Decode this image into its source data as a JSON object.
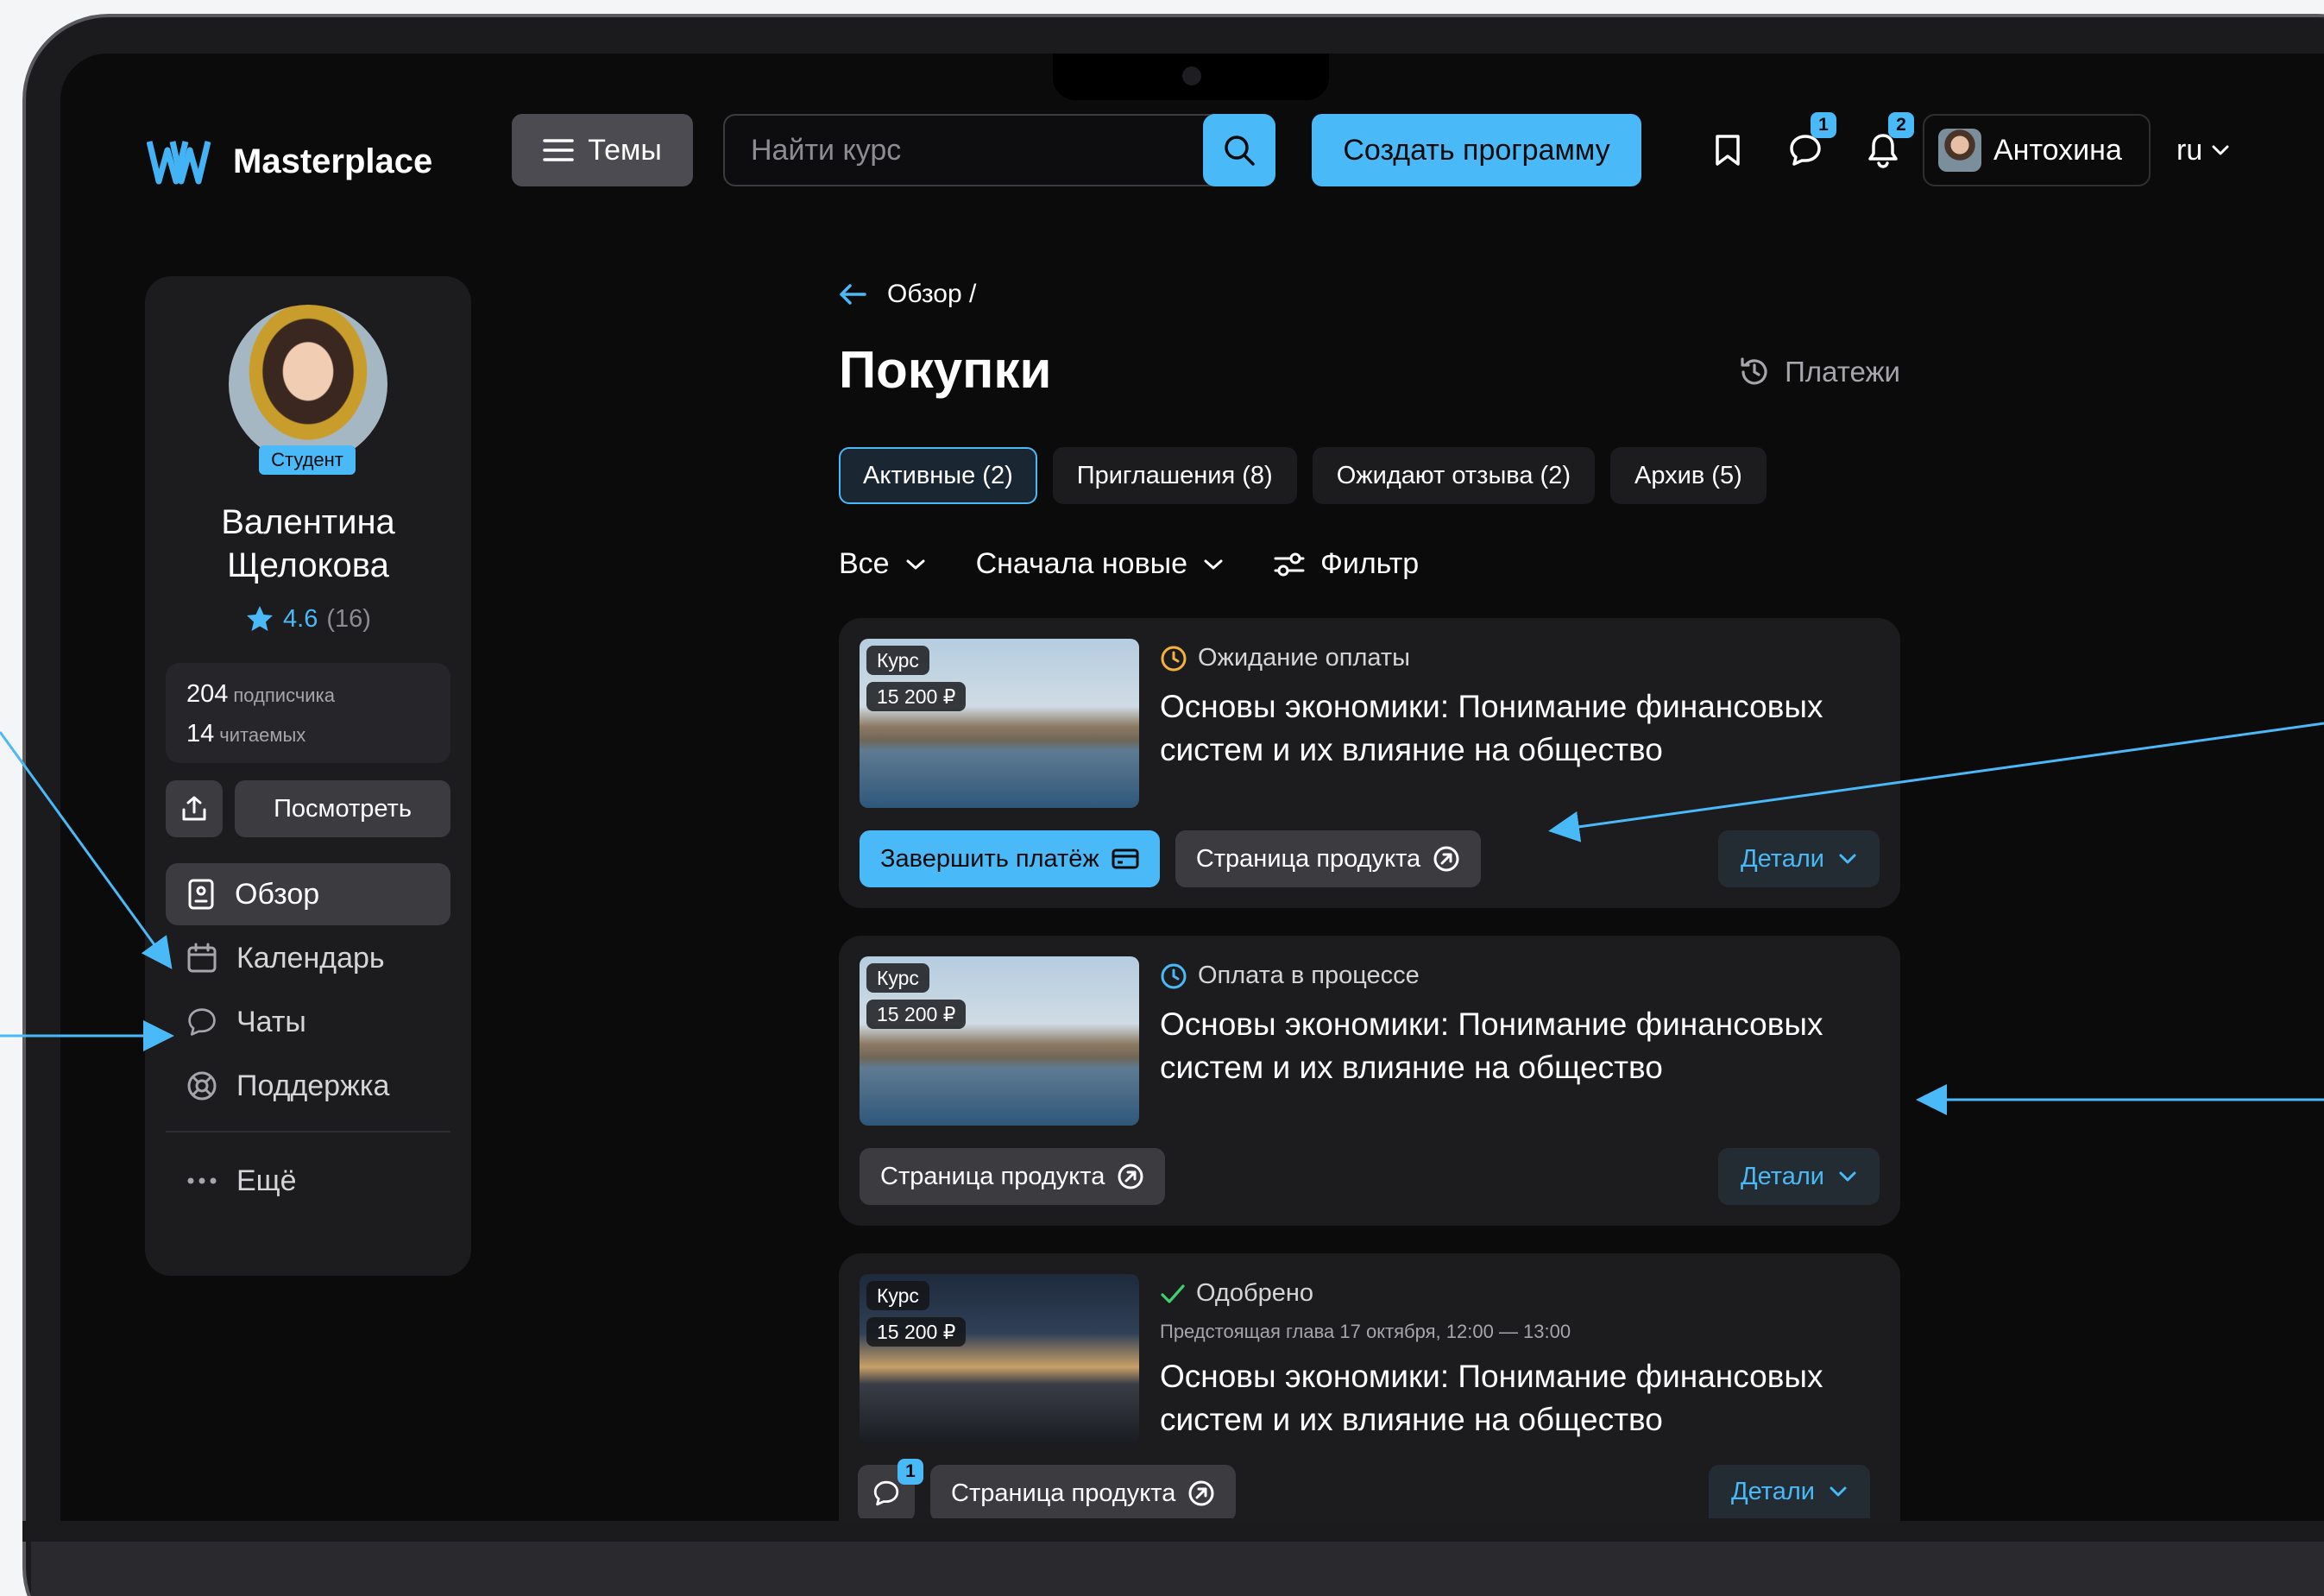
{
  "header": {
    "logo_mark": "W",
    "app_name": "Masterplace",
    "topics_label": "Темы",
    "search_placeholder": "Найти курс",
    "create_label": "Создать программу",
    "chat_badge": "1",
    "notifications_badge": "2",
    "user_name": "Антохина",
    "language": "ru"
  },
  "profile": {
    "role": "Студент",
    "name": "Валентина Щелокова",
    "rating": "4.6",
    "rating_count": "(16)",
    "subscribers_count": "204",
    "subscribers_label": "подписчика",
    "following_count": "14",
    "following_label": "читаемых",
    "view_label": "Посмотреть"
  },
  "nav": {
    "items": [
      {
        "label": "Обзор",
        "icon": "overview-icon",
        "active": true
      },
      {
        "label": "Календарь",
        "icon": "calendar-icon"
      },
      {
        "label": "Чаты",
        "icon": "chat-icon"
      },
      {
        "label": "Поддержка",
        "icon": "support-icon"
      }
    ],
    "more_label": "Ещё"
  },
  "page": {
    "breadcrumb": "Обзор /",
    "title": "Покупки",
    "payments_label": "Платежи",
    "tabs": [
      "Активные (2)",
      "Приглашения (8)",
      "Ожидают отзыва (2)",
      "Архив (5)"
    ],
    "filter_scope": "Все",
    "sort": "Сначала новые",
    "filter_label": "Фильтр"
  },
  "purchases": [
    {
      "type_label": "Курс",
      "price": "15 200 ₽",
      "status": "Ожидание оплаты",
      "status_color": "#f5b13d",
      "title": "Основы экономики: Понимание финансовых систем и их влияние на общество",
      "pay_label": "Завершить платёж",
      "product_label": "Страница продукта",
      "details_label": "Детали"
    },
    {
      "type_label": "Курс",
      "price": "15 200 ₽",
      "status": "Оплата в процессе",
      "status_color": "#4ab9f7",
      "title": "Основы экономики: Понимание финансовых систем и их влияние на общество",
      "product_label": "Страница продукта",
      "details_label": "Детали"
    },
    {
      "type_label": "Курс",
      "price": "15 200 ₽",
      "status": "Одобрено",
      "status_color": "#3ecf6e",
      "next_chapter": "Предстоящая глава 17 октября, 12:00 — 13:00",
      "title": "Основы экономики: Понимание финансовых систем и их влияние на общество",
      "chat_badge": "1",
      "product_label": "Страница продукта",
      "details_label": "Детали"
    }
  ],
  "colors": {
    "accent": "#4ab9f7",
    "background": "#0b0b0c",
    "panel": "#1c1c1f"
  }
}
